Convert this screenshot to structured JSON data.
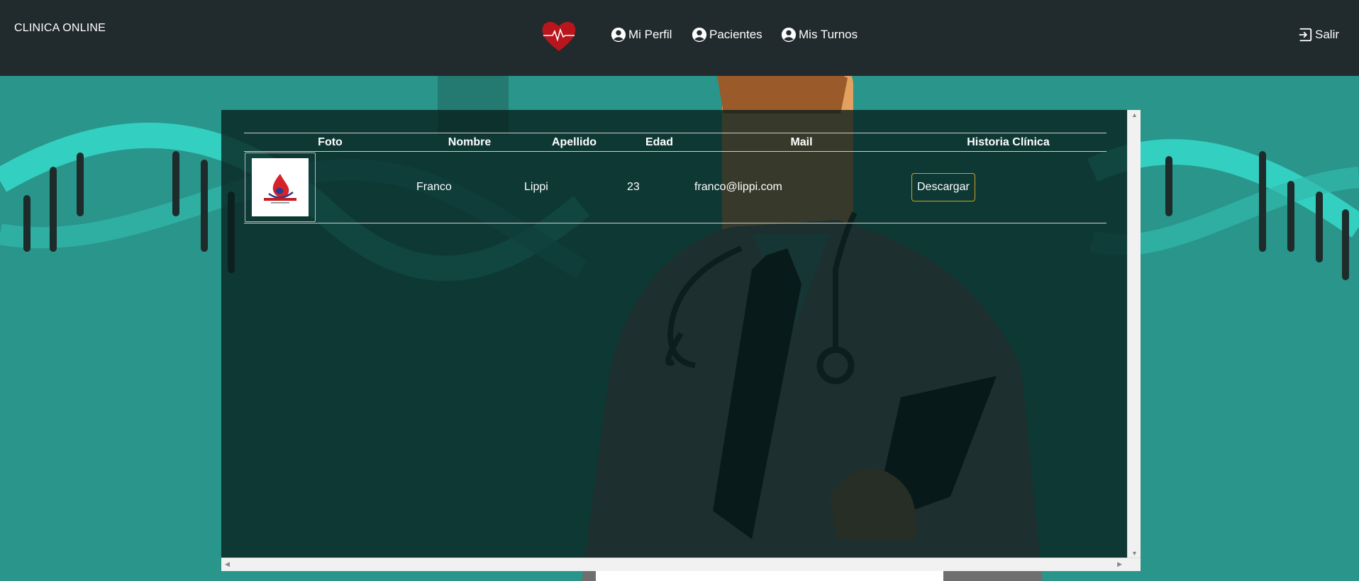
{
  "app": {
    "brand": "CLINICA ONLINE",
    "logo_icon": "heart-pulse-icon"
  },
  "nav": {
    "items": [
      {
        "label": "Mi Perfil",
        "icon": "account-circle-icon"
      },
      {
        "label": "Pacientes",
        "icon": "account-circle-icon"
      },
      {
        "label": "Mis Turnos",
        "icon": "account-circle-icon"
      }
    ],
    "logout": {
      "label": "Salir",
      "icon": "logout-icon"
    }
  },
  "table": {
    "headers": [
      "Foto",
      "Nombre",
      "Apellido",
      "Edad",
      "Mail",
      "Historia Clínica"
    ],
    "rows": [
      {
        "foto_icon": "clinica-online-logo",
        "nombre": "Franco",
        "apellido": "Lippi",
        "edad": "23",
        "mail": "franco@lippi.com",
        "action_label": "Descargar"
      }
    ]
  },
  "colors": {
    "navbar": "#212a2d",
    "background": "#2a958a",
    "button_border": "#c9a227",
    "heart": "#b8161c"
  }
}
